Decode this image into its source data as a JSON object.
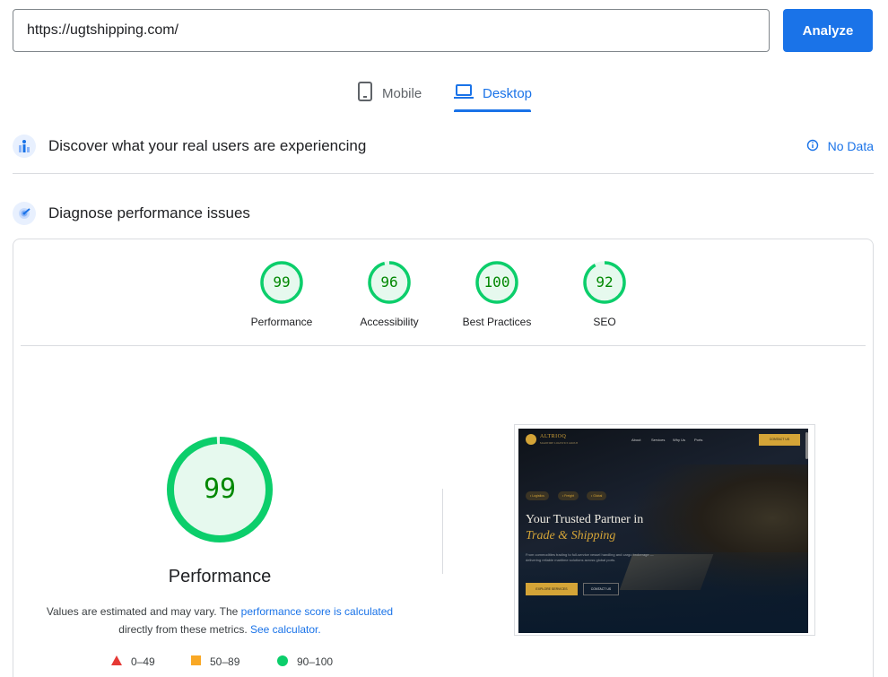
{
  "search": {
    "value": "https://ugtshipping.com/",
    "analyze_label": "Analyze"
  },
  "tabs": [
    {
      "label": "Mobile",
      "icon": "smartphone-icon",
      "active": false
    },
    {
      "label": "Desktop",
      "icon": "laptop-icon",
      "active": true
    }
  ],
  "field_data": {
    "title": "Discover what your real users are experiencing",
    "status": "No Data"
  },
  "lab_data": {
    "title": "Diagnose performance issues"
  },
  "scores": [
    {
      "value": "99",
      "label": "Performance"
    },
    {
      "value": "96",
      "label": "Accessibility"
    },
    {
      "value": "100",
      "label": "Best Practices"
    },
    {
      "value": "92",
      "label": "SEO"
    }
  ],
  "performance": {
    "score": "99",
    "title": "Performance",
    "note_prefix": "Values are estimated and may vary. The ",
    "note_link1": "performance score is calculated",
    "note_middle": " directly from these metrics.",
    "note_link2": "See calculator."
  },
  "legend": [
    {
      "range": "0–49",
      "color": "#e53935"
    },
    {
      "range": "50–89",
      "color": "#f9a825"
    },
    {
      "range": "90–100",
      "color": "#0cce6b"
    }
  ],
  "thumbnail": {
    "brand": "ALTRIOQ",
    "brand_sub": "MARITIME LOGISTICS GROUP",
    "nav": [
      "About",
      "Services",
      "Why Us",
      "Ports"
    ],
    "contact_top": "CONTACT US",
    "chips": [
      "• Logistics",
      "• Freight",
      "• Global"
    ],
    "headline1": "Your Trusted Partner in",
    "headline2": "Trade & Shipping",
    "description": "From commodities trading to full-service vessel handling and cargo brokerage — delivering reliable maritime solutions across global ports.",
    "cta_primary": "EXPLORE SERVICES",
    "cta_secondary": "CONTACT US"
  },
  "colors": {
    "accent": "#1a73e8",
    "pass": "#0cce6b",
    "pass_text": "#008800"
  }
}
